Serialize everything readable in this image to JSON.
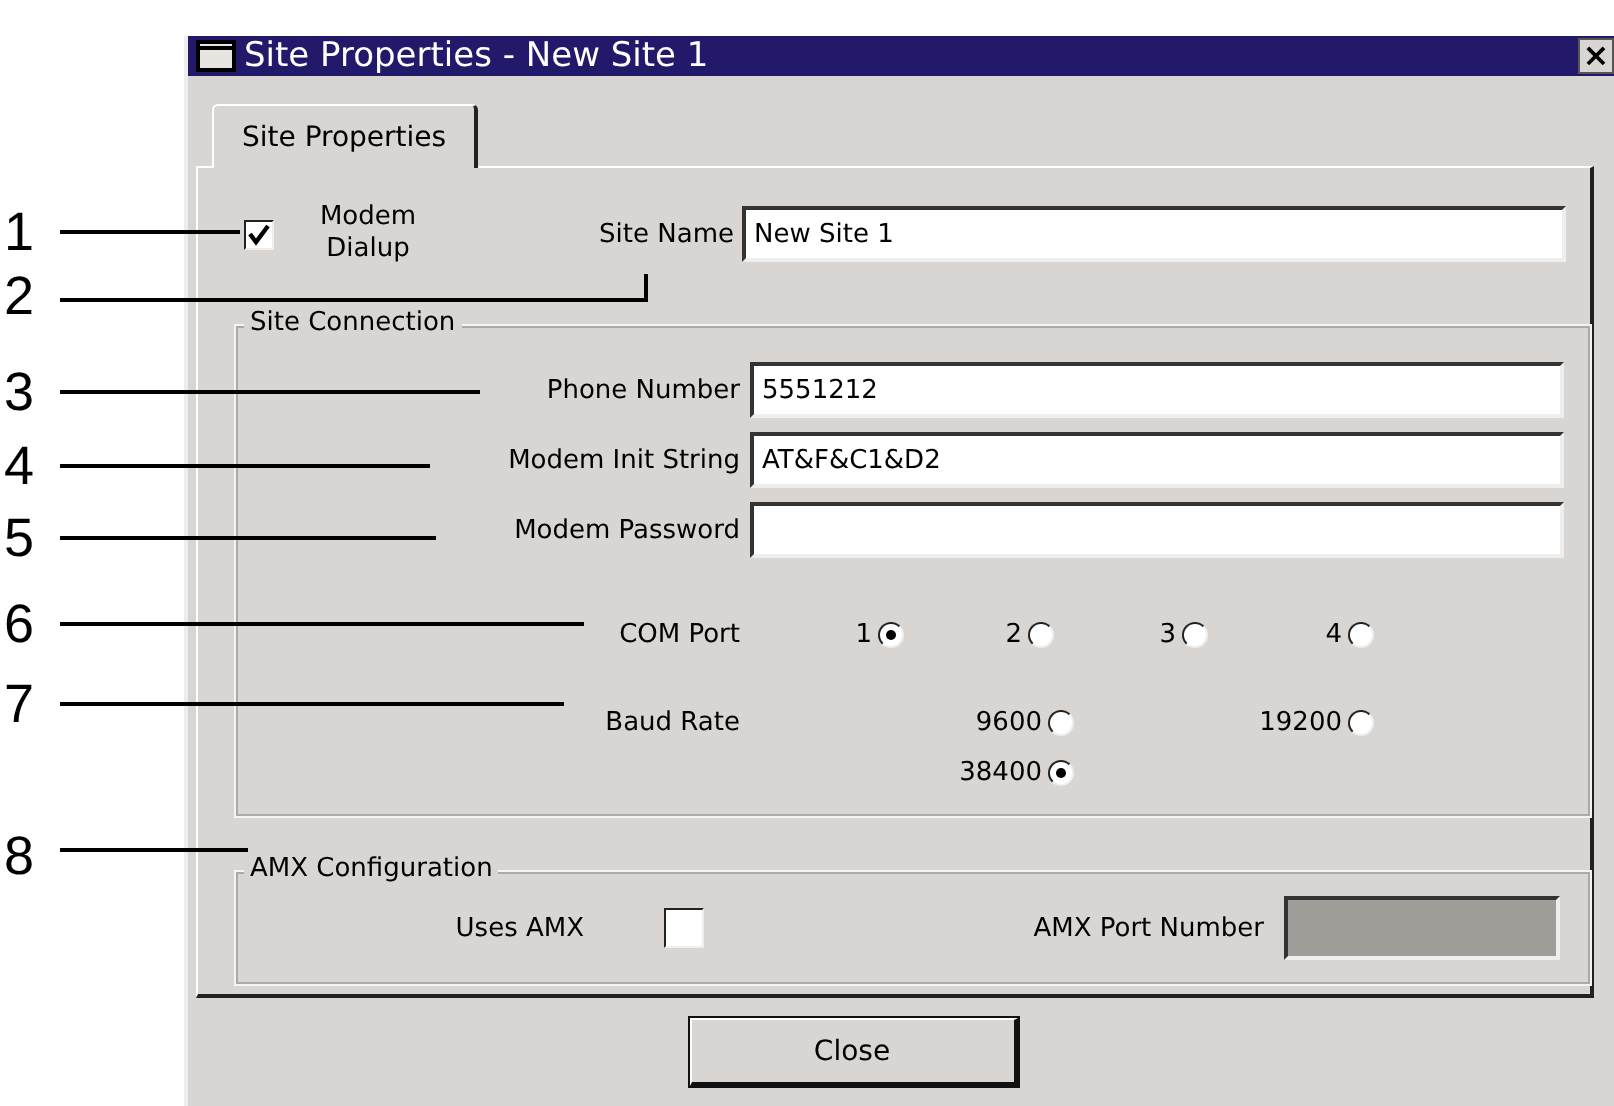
{
  "window": {
    "title": "Site Properties - New Site 1",
    "close": "×"
  },
  "tabs": [
    {
      "label": "Site Properties",
      "selected": true
    }
  ],
  "modem_dialup": {
    "label": "Modem Dialup",
    "checked": true
  },
  "site_name": {
    "label": "Site Name",
    "value": "New Site 1"
  },
  "site_connection": {
    "title": "Site Connection",
    "fields": [
      {
        "label": "Phone Number",
        "value": "5551212"
      },
      {
        "label": "Modem Init String",
        "value": "AT&F&C1&D2"
      },
      {
        "label": "Modem Password"
      }
    ],
    "com_port": {
      "label": "COM Port",
      "options": [
        {
          "label": "1",
          "selected": true
        },
        {
          "label": "2",
          "selected": false
        },
        {
          "label": "3",
          "selected": false
        },
        {
          "label": "4",
          "selected": false
        }
      ]
    },
    "baud_rate": {
      "label": "Baud Rate",
      "options": [
        {
          "label": "9600",
          "selected": false
        },
        {
          "label": "19200",
          "selected": false
        },
        {
          "label": "38400",
          "selected": true
        }
      ]
    }
  },
  "amx": {
    "title": "AMX Configuration",
    "uses_label": "Uses AMX",
    "uses_checked": false,
    "port_label": "AMX Port Number",
    "port_disabled": true
  },
  "buttons": [
    "Close"
  ],
  "callouts": [
    "1",
    "2",
    "3",
    "4",
    "5",
    "6",
    "7",
    "8"
  ]
}
